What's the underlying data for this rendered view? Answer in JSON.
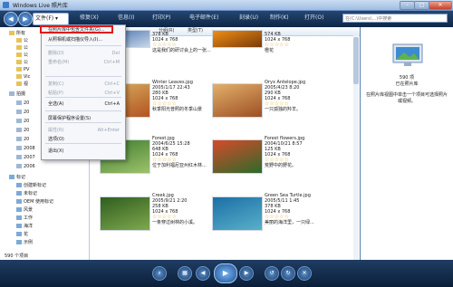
{
  "window": {
    "title": "Windows Live 照片库"
  },
  "toolbar": {
    "file": "文件(F)",
    "fix": "修复(X)",
    "info": "信息(I)",
    "print": "打印(P)",
    "email": "电子邮件(E)",
    "burn": "刻录(U)",
    "make": "制作(K)",
    "open": "打开(O)",
    "search_placeholder": "在(C:\\Users\\...)中搜索"
  },
  "file_menu": {
    "items": [
      {
        "label": "在照片库中包含文件夹(G)...",
        "shortcut": "",
        "enabled": true
      },
      {
        "label": "从照相机或扫描仪导入(I)...",
        "shortcut": "",
        "enabled": true
      },
      {
        "label": "删除(D)",
        "shortcut": "Del",
        "enabled": false
      },
      {
        "label": "重命名(M)",
        "shortcut": "Ctrl+M",
        "enabled": false
      },
      {
        "label": "复制(C)",
        "shortcut": "Ctrl+C",
        "enabled": false
      },
      {
        "label": "粘贴(P)",
        "shortcut": "Ctrl+V",
        "enabled": false
      },
      {
        "label": "全选(A)",
        "shortcut": "Ctrl+A",
        "enabled": true
      },
      {
        "label": "屏幕保护程序设置(S)",
        "shortcut": "",
        "enabled": true
      },
      {
        "label": "属性(R)",
        "shortcut": "Alt+Enter",
        "enabled": false
      },
      {
        "label": "选项(O)",
        "shortcut": "",
        "enabled": true
      },
      {
        "label": "退出(X)",
        "shortcut": "",
        "enabled": true
      }
    ]
  },
  "sidebar": {
    "items": [
      {
        "label": "所有",
        "icon": "folder"
      },
      {
        "label": "公",
        "icon": "folder"
      },
      {
        "label": "公",
        "icon": "folder"
      },
      {
        "label": "公",
        "icon": "folder"
      },
      {
        "label": "公",
        "icon": "folder"
      },
      {
        "label": "PV",
        "icon": "folder"
      },
      {
        "label": "Vic",
        "icon": "folder"
      },
      {
        "label": "视",
        "icon": "folder"
      },
      {
        "label": "拍摄",
        "icon": "calendar"
      },
      {
        "label": "20",
        "icon": "calendar"
      },
      {
        "label": "20",
        "icon": "calendar"
      },
      {
        "label": "20",
        "icon": "calendar"
      },
      {
        "label": "20",
        "icon": "calendar"
      },
      {
        "label": "20",
        "icon": "calendar"
      },
      {
        "label": "2008",
        "icon": "calendar"
      },
      {
        "label": "2007",
        "icon": "calendar"
      },
      {
        "label": "2006",
        "icon": "calendar"
      },
      {
        "label": "标记",
        "icon": "tag"
      },
      {
        "label": "创建新标记",
        "icon": "tag"
      },
      {
        "label": "未标记",
        "icon": "tag"
      },
      {
        "label": "OEM 使用标记",
        "icon": "tag"
      },
      {
        "label": "风景",
        "icon": "tag"
      },
      {
        "label": "工作",
        "icon": "tag"
      },
      {
        "label": "海洋",
        "icon": "tag"
      },
      {
        "label": "花",
        "icon": "tag"
      },
      {
        "label": "示例",
        "icon": "tag"
      }
    ],
    "status": "590 个项目"
  },
  "columns": {
    "group": "分组(R)",
    "type": "类型(T)"
  },
  "photos": [
    {
      "name": "",
      "date": "",
      "size": "378 KB",
      "dims": "1024 x 768",
      "caption": "这是我们的研讨会上的一张..."
    },
    {
      "name": "",
      "date": "",
      "size": "574 KB",
      "dims": "1024 x 768",
      "caption": "橙花"
    },
    {
      "name": "Winter Leaves.jpg",
      "date": "2005/1/17 22:43",
      "size": "280 KB",
      "dims": "1024 x 768",
      "caption": "秋季阳光普照的冬季山景"
    },
    {
      "name": "Oryx Antelope.jpg",
      "date": "2005/4/23 8:20",
      "size": "290 KB",
      "dims": "1024 x 768",
      "caption": "一只孤独的羚羊。"
    },
    {
      "name": "Forest.jpg",
      "date": "2004/6/25 15:28",
      "size": "648 KB",
      "dims": "1024 x 768",
      "caption": "位于加利福尼亚州红木林..."
    },
    {
      "name": "Forest flowers.jpg",
      "date": "2004/10/21 8:57",
      "size": "125 KB",
      "dims": "1024 x 768",
      "caption": "荒野中的野花。"
    },
    {
      "name": "Creek.jpg",
      "date": "2005/9/21 2:20",
      "size": "258 KB",
      "dims": "1024 x 768",
      "caption": "一条穿过树林的小溪。"
    },
    {
      "name": "Green Sea Turtle.jpg",
      "date": "2005/5/11 1:45",
      "size": "378 KB",
      "dims": "1024 x 768",
      "caption": "美丽的海洋里，一只绿..."
    }
  ],
  "info_pane": {
    "count": "590 项",
    "header": "已在照片库",
    "message": "在照片库视图中单击一个项目可选择照片或视频。"
  },
  "colors": {
    "accent": "#1f4f8c",
    "highlight": "#e01818",
    "toolbar": "#1b3a62"
  }
}
